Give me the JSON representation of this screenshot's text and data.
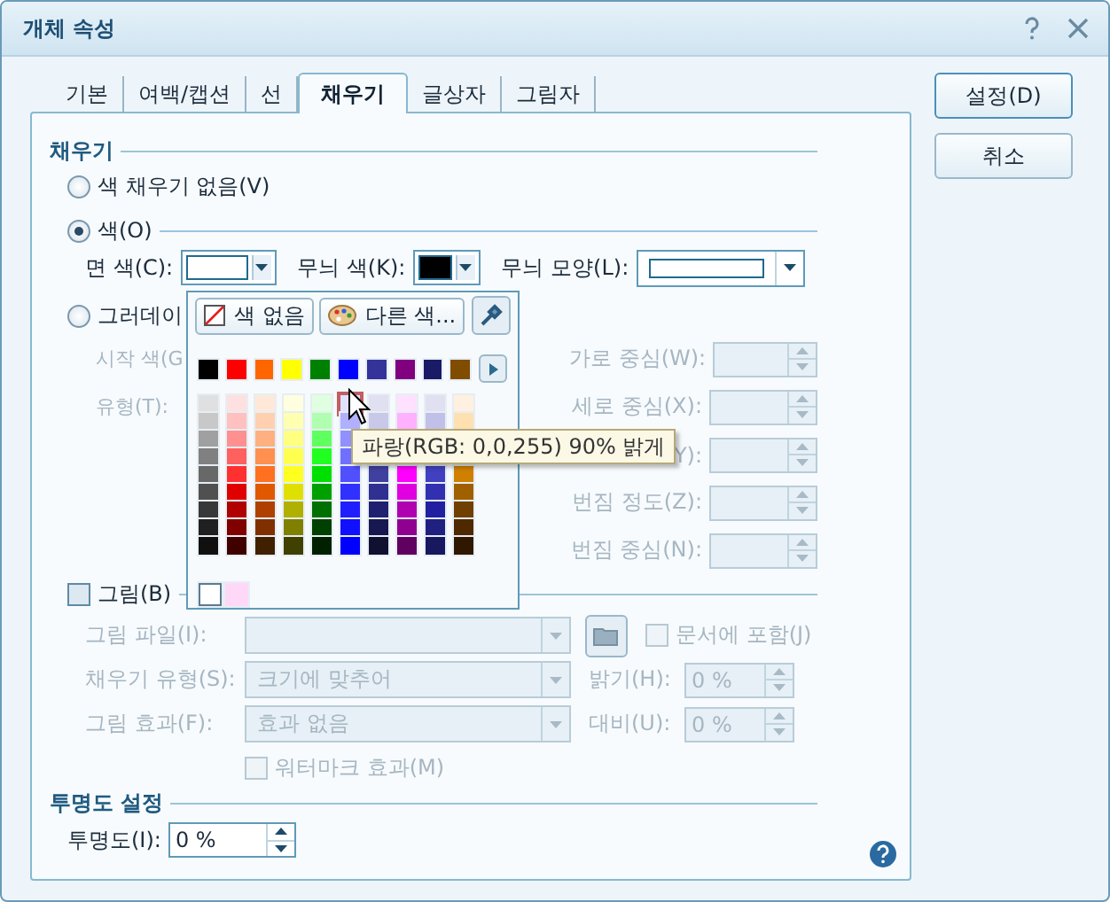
{
  "window": {
    "title": "개체 속성"
  },
  "tabs": [
    {
      "label": "기본",
      "selected": false
    },
    {
      "label": "여백/캡션",
      "selected": false
    },
    {
      "label": "선",
      "selected": false
    },
    {
      "label": "채우기",
      "selected": true
    },
    {
      "label": "글상자",
      "selected": false
    },
    {
      "label": "그림자",
      "selected": false
    }
  ],
  "buttons": [
    "설정(D)",
    "취소"
  ],
  "fill": {
    "heading": "채우기",
    "modes": [
      {
        "label": "색 채우기 없음(V)",
        "selected": false
      },
      {
        "label": "색(O)",
        "selected": true
      }
    ],
    "face_color": {
      "label": "면 색(C):",
      "color": "#ffffff"
    },
    "pattern_color": {
      "label": "무늬 색(K):",
      "color": "#000000"
    },
    "pattern_shape": {
      "label": "무늬 모양(L):"
    }
  },
  "gradient": {
    "label": "그러데이",
    "selected": false,
    "disabled": true,
    "start_color_label": "시작 색(G",
    "type_label": "유형(T):",
    "fields": [
      {
        "label": "가로 중심(W):"
      },
      {
        "label": "세로 중심(X):"
      },
      {
        "label": "Y):"
      },
      {
        "label": "번짐 정도(Z):"
      },
      {
        "label": "번짐 중심(N):"
      }
    ]
  },
  "picture": {
    "label": "그림(B)",
    "checked": false,
    "disabled": true,
    "file_label": "그림 파일(I):",
    "embed": {
      "label": "문서에 포함(J)",
      "checked": false
    },
    "fill_type": {
      "label": "채우기 유형(S):",
      "value": "크기에 맞추어"
    },
    "brightness": {
      "label": "밝기(H):",
      "value": "0 %"
    },
    "effect": {
      "label": "그림 효과(F):",
      "value": "효과 없음"
    },
    "contrast": {
      "label": "대비(U):",
      "value": "0 %"
    },
    "watermark": {
      "label": "워터마크 효과(M)",
      "checked": false
    }
  },
  "transparency": {
    "heading": "투명도 설정",
    "label": "투명도(I):",
    "value": "0 %"
  },
  "color_popup": {
    "no_color": "색 없음",
    "more_colors": "다른 색...",
    "base_colors": [
      {
        "color": "#000000"
      },
      {
        "color": "#ff0000"
      },
      {
        "color": "#ff6600"
      },
      {
        "color": "#ffff00"
      },
      {
        "color": "#008000"
      },
      {
        "color": "#0000ff"
      },
      {
        "color": "#333399"
      },
      {
        "color": "#800080"
      },
      {
        "color": "#1a1a66"
      },
      {
        "color": "#804c00"
      }
    ],
    "columns": [
      [
        {
          "color": "#e0e0e0",
          "selected": false
        },
        {
          "color": "#c8c8c8",
          "selected": false
        },
        {
          "color": "#a0a0a0",
          "selected": false
        },
        {
          "color": "#808080",
          "selected": false
        },
        {
          "color": "#686868",
          "selected": false
        },
        {
          "color": "#505050",
          "selected": false
        },
        {
          "color": "#383838",
          "selected": false
        },
        {
          "color": "#202020",
          "selected": false
        },
        {
          "color": "#101010",
          "selected": false
        }
      ],
      [
        {
          "color": "#ffe0e0",
          "selected": false
        },
        {
          "color": "#ffc0c0",
          "selected": false
        },
        {
          "color": "#ff9090",
          "selected": false
        },
        {
          "color": "#ff6060",
          "selected": false
        },
        {
          "color": "#ff3030",
          "selected": false
        },
        {
          "color": "#e00000",
          "selected": false
        },
        {
          "color": "#b00000",
          "selected": false
        },
        {
          "color": "#800000",
          "selected": false
        },
        {
          "color": "#400000",
          "selected": false
        }
      ],
      [
        {
          "color": "#ffe8d8",
          "selected": false
        },
        {
          "color": "#ffd0b0",
          "selected": false
        },
        {
          "color": "#ffb080",
          "selected": false
        },
        {
          "color": "#ff9050",
          "selected": false
        },
        {
          "color": "#ff7020",
          "selected": false
        },
        {
          "color": "#e05800",
          "selected": false
        },
        {
          "color": "#b04000",
          "selected": false
        },
        {
          "color": "#803000",
          "selected": false
        },
        {
          "color": "#402000",
          "selected": false
        }
      ],
      [
        {
          "color": "#ffffe0",
          "selected": false
        },
        {
          "color": "#ffffb0",
          "selected": false
        },
        {
          "color": "#ffff80",
          "selected": false
        },
        {
          "color": "#ffff50",
          "selected": false
        },
        {
          "color": "#ffff20",
          "selected": false
        },
        {
          "color": "#e0e000",
          "selected": false
        },
        {
          "color": "#b0b000",
          "selected": false
        },
        {
          "color": "#808000",
          "selected": false
        },
        {
          "color": "#404000",
          "selected": false
        }
      ],
      [
        {
          "color": "#e0ffe0",
          "selected": false
        },
        {
          "color": "#b0ffb0",
          "selected": false
        },
        {
          "color": "#60ff60",
          "selected": false
        },
        {
          "color": "#20ff20",
          "selected": false
        },
        {
          "color": "#00e000",
          "selected": false
        },
        {
          "color": "#00a000",
          "selected": false
        },
        {
          "color": "#007000",
          "selected": false
        },
        {
          "color": "#004000",
          "selected": false
        },
        {
          "color": "#002000",
          "selected": false
        }
      ],
      [
        {
          "color": "#e0e0ff",
          "selected": true
        },
        {
          "color": "#b0b0ff",
          "selected": false
        },
        {
          "color": "#9090ff",
          "selected": false
        },
        {
          "color": "#7070ff",
          "selected": false
        },
        {
          "color": "#5050ff",
          "selected": false
        },
        {
          "color": "#3030ff",
          "selected": false
        },
        {
          "color": "#2020ff",
          "selected": false
        },
        {
          "color": "#1010ff",
          "selected": false
        },
        {
          "color": "#0000ff",
          "selected": false
        }
      ],
      [
        {
          "color": "#e0e0f0",
          "selected": false
        },
        {
          "color": "#c8c8e8",
          "selected": false
        },
        null,
        null,
        {
          "color": "#4040a0",
          "selected": false
        },
        {
          "color": "#303090",
          "selected": false
        },
        {
          "color": "#202070",
          "selected": false
        },
        {
          "color": "#181850",
          "selected": false
        },
        {
          "color": "#101030",
          "selected": false
        }
      ],
      [
        {
          "color": "#ffe0ff",
          "selected": false
        },
        {
          "color": "#ffb0ff",
          "selected": false
        },
        null,
        null,
        {
          "color": "#ff00ff",
          "selected": false
        },
        {
          "color": "#e000e0",
          "selected": false
        },
        {
          "color": "#b000b0",
          "selected": false
        },
        {
          "color": "#900090",
          "selected": false
        },
        {
          "color": "#600060",
          "selected": false
        }
      ],
      [
        {
          "color": "#e0e0f0",
          "selected": false
        },
        {
          "color": "#c0c0e8",
          "selected": false
        },
        null,
        null,
        {
          "color": "#4040c0",
          "selected": false
        },
        {
          "color": "#3030b0",
          "selected": false
        },
        {
          "color": "#2020a0",
          "selected": false
        },
        {
          "color": "#202080",
          "selected": false
        },
        {
          "color": "#181860",
          "selected": false
        }
      ],
      [
        {
          "color": "#fff0e0",
          "selected": false
        },
        {
          "color": "#ffe0b0",
          "selected": false
        },
        null,
        null,
        {
          "color": "#d08000",
          "selected": false
        },
        {
          "color": "#a06000",
          "selected": false
        },
        {
          "color": "#704000",
          "selected": false
        },
        {
          "color": "#502800",
          "selected": false
        },
        {
          "color": "#301800",
          "selected": false
        }
      ]
    ],
    "recent_colors": [
      {
        "color": "#ffffff"
      },
      {
        "color": "#ffd8f8"
      }
    ]
  },
  "tooltip": "파랑(RGB: 0,0,255) 90% 밝게"
}
